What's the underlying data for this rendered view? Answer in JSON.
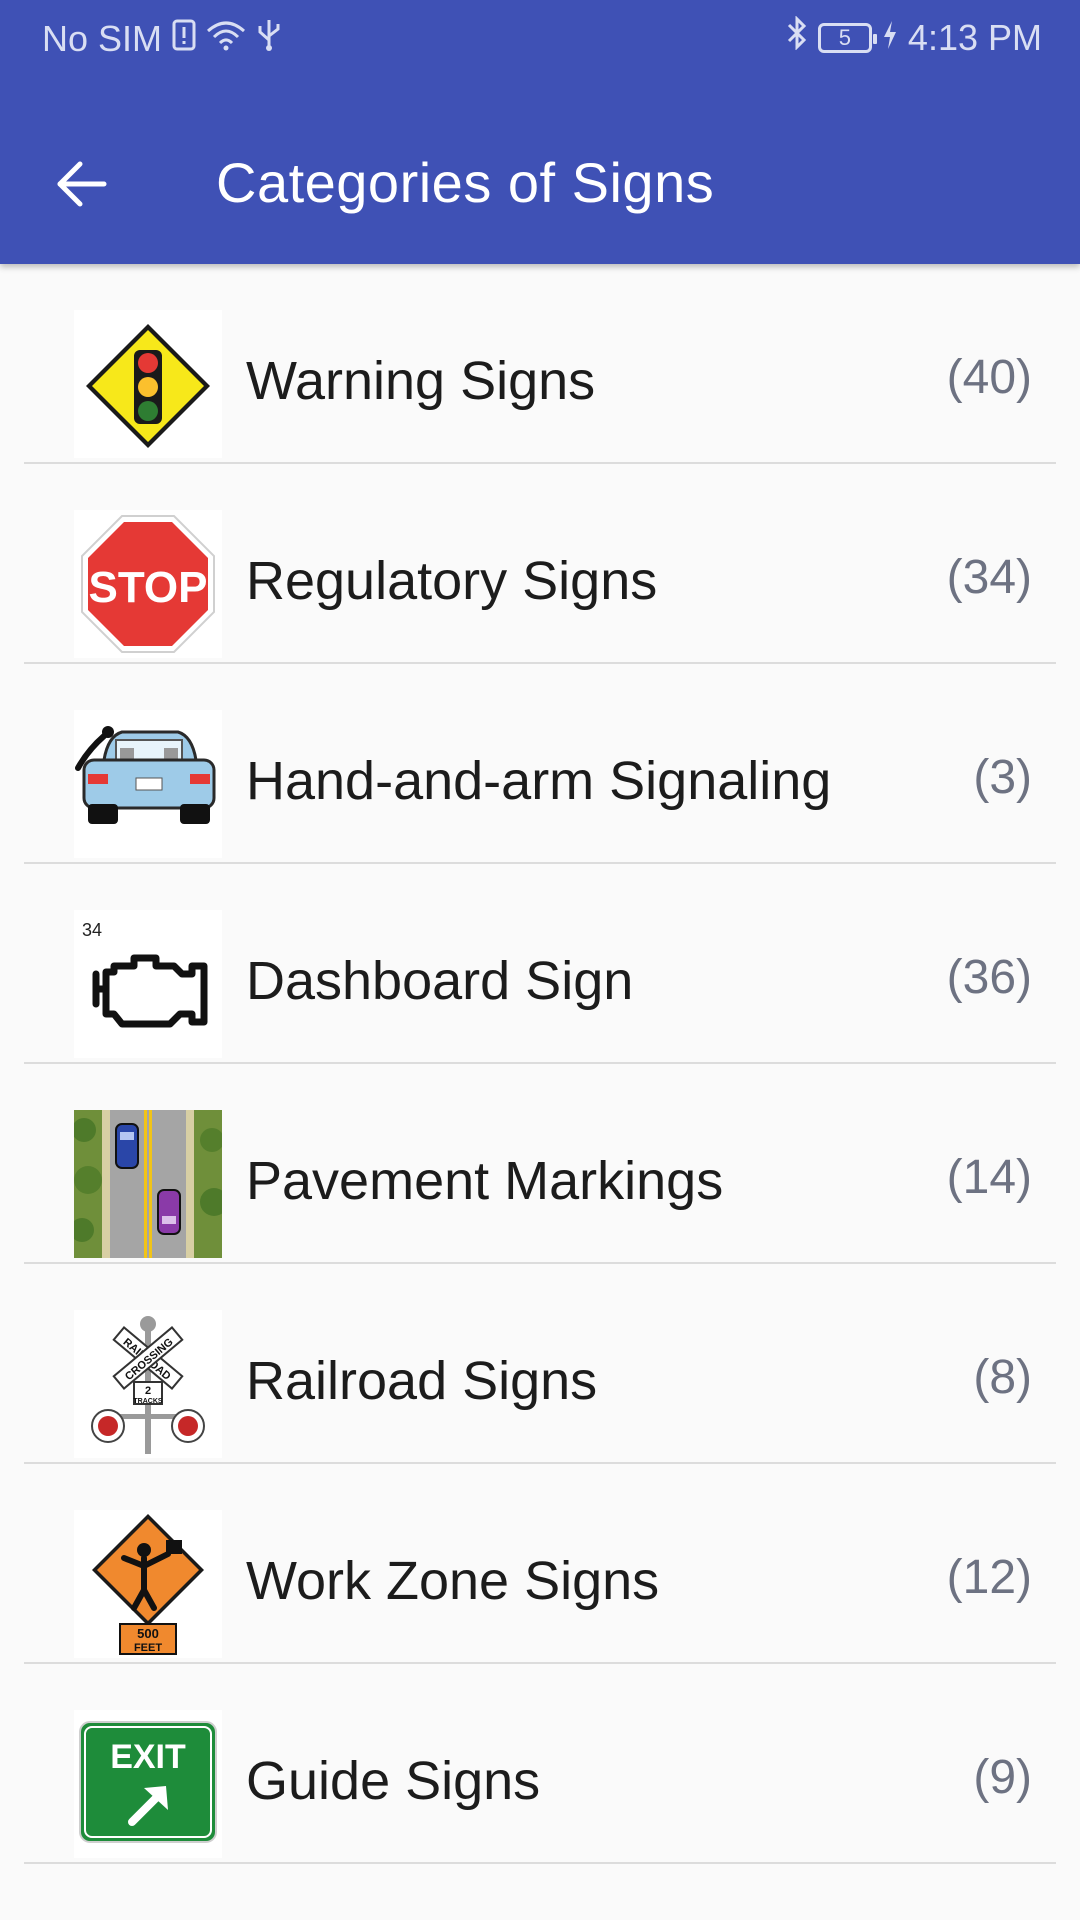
{
  "status_bar": {
    "carrier": "No SIM",
    "battery_level": "5",
    "time": "4:13 PM"
  },
  "toolbar": {
    "title": "Categories of Signs"
  },
  "categories": [
    {
      "label": "Warning Signs",
      "count": "(40)",
      "icon": "traffic-light-warning-sign"
    },
    {
      "label": "Regulatory Signs",
      "count": "(34)",
      "icon": "stop-sign"
    },
    {
      "label": "Hand-and-arm Signaling",
      "count": "(3)",
      "icon": "car-rear-hand-signal"
    },
    {
      "label": "Dashboard Sign",
      "count": "(36)",
      "icon": "check-engine-light",
      "icon_badge": "34"
    },
    {
      "label": "Pavement Markings",
      "count": "(14)",
      "icon": "road-with-cars"
    },
    {
      "label": "Railroad Signs",
      "count": "(8)",
      "icon": "railroad-crossing-sign",
      "icon_text": [
        "RAILROAD",
        "CROSSING",
        "2",
        "TRACKS"
      ]
    },
    {
      "label": "Work Zone Signs",
      "count": "(12)",
      "icon": "flagger-sign",
      "icon_text": [
        "500",
        "FEET"
      ]
    },
    {
      "label": "Guide Signs",
      "count": "(9)",
      "icon": "exit-sign",
      "icon_text": [
        "EXIT"
      ]
    }
  ],
  "colors": {
    "app_bar": "#3f51b5",
    "background": "#fafafa",
    "count_text": "#6d7282"
  }
}
